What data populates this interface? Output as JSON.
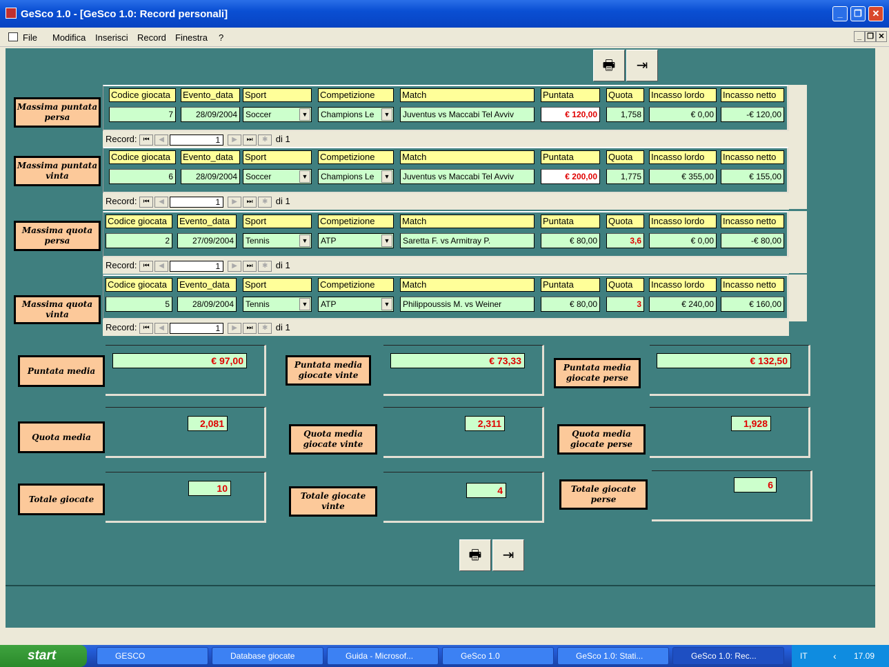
{
  "window": {
    "title": "GeSco 1.0 - [GeSco 1.0: Record personali]"
  },
  "menu": {
    "items": [
      "File",
      "Modifica",
      "Inserisci",
      "Record",
      "Finestra",
      "?"
    ]
  },
  "headers": [
    "Codice giocata",
    "Evento_data",
    "Sport",
    "Competizione",
    "Match",
    "Puntata",
    "Quota",
    "Incasso lordo",
    "Incasso netto"
  ],
  "sections": [
    {
      "label": "Massima puntata persa",
      "codice": "7",
      "data": "28/09/2004",
      "sport": "Soccer",
      "competizione": "Champions Le",
      "match": "Juventus vs Maccabi Tel Avviv",
      "puntata": "€ 120,00",
      "quota": "1,758",
      "lordo": "€ 0,00",
      "netto": "-€ 120,00"
    },
    {
      "label": "Massima puntata vinta",
      "codice": "6",
      "data": "28/09/2004",
      "sport": "Soccer",
      "competizione": "Champions Le",
      "match": "Juventus vs Maccabi Tel Avviv",
      "puntata": "€ 200,00",
      "quota": "1,775",
      "lordo": "€ 355,00",
      "netto": "€ 155,00"
    },
    {
      "label": "Massima quota persa",
      "codice": "2",
      "data": "27/09/2004",
      "sport": "Tennis",
      "competizione": "ATP",
      "match": "Saretta F. vs Armitray P.",
      "puntata": "€ 80,00",
      "quota": "3,6",
      "lordo": "€ 0,00",
      "netto": "-€ 80,00"
    },
    {
      "label": "Massima quota vinta",
      "codice": "5",
      "data": "28/09/2004",
      "sport": "Tennis",
      "competizione": "ATP",
      "match": "Philippoussis M. vs Weiner",
      "puntata": "€ 80,00",
      "quota": "3",
      "lordo": "€ 240,00",
      "netto": "€ 160,00"
    }
  ],
  "nav": {
    "label": "Record:",
    "current": "1",
    "of": "di 1"
  },
  "summary": {
    "puntata_media": {
      "label": "Puntata media",
      "value": "€ 97,00"
    },
    "puntata_media_vinte": {
      "label": "Puntata media giocate vinte",
      "value": "€ 73,33"
    },
    "puntata_media_perse": {
      "label": "Puntata media giocate perse",
      "value": "€ 132,50"
    },
    "quota_media": {
      "label": "Quota media",
      "value": "2,081"
    },
    "quota_media_vinte": {
      "label": "Quota media giocate vinte",
      "value": "2,311"
    },
    "quota_media_perse": {
      "label": "Quota media giocate perse",
      "value": "1,928"
    },
    "totale": {
      "label": "Totale giocate",
      "value": "10"
    },
    "totale_vinte": {
      "label": "Totale giocate vinte",
      "value": "4"
    },
    "totale_perse": {
      "label": "Totale giocate perse",
      "value": "6"
    }
  },
  "icons": {
    "print": "print-icon",
    "exit": "exit-door-icon"
  },
  "taskbar": {
    "start": "start",
    "items": [
      "GESCO",
      "Database giocate",
      "Guida - Microsof...",
      "GeSco 1.0",
      "GeSco 1.0: Stati...",
      "GeSco 1.0: Rec..."
    ],
    "lang": "IT",
    "clock": "17.09"
  }
}
